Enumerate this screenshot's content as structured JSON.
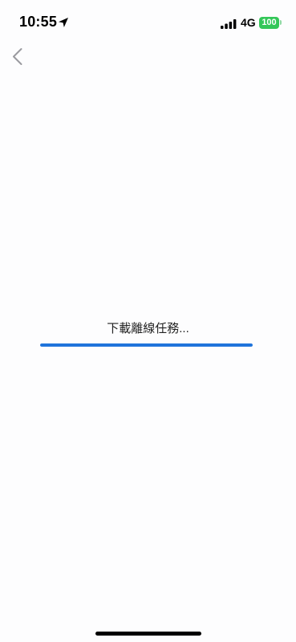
{
  "status_bar": {
    "time": "10:55",
    "network": "4G",
    "battery": "100",
    "battery_color": "#34c759",
    "icons": [
      "location-arrow-icon",
      "signal-bars-icon"
    ]
  },
  "nav": {
    "back_icon": "chevron-left-icon"
  },
  "loading": {
    "label": "下載離線任務...",
    "progress": 1.0,
    "progress_color": "#1f74db"
  }
}
